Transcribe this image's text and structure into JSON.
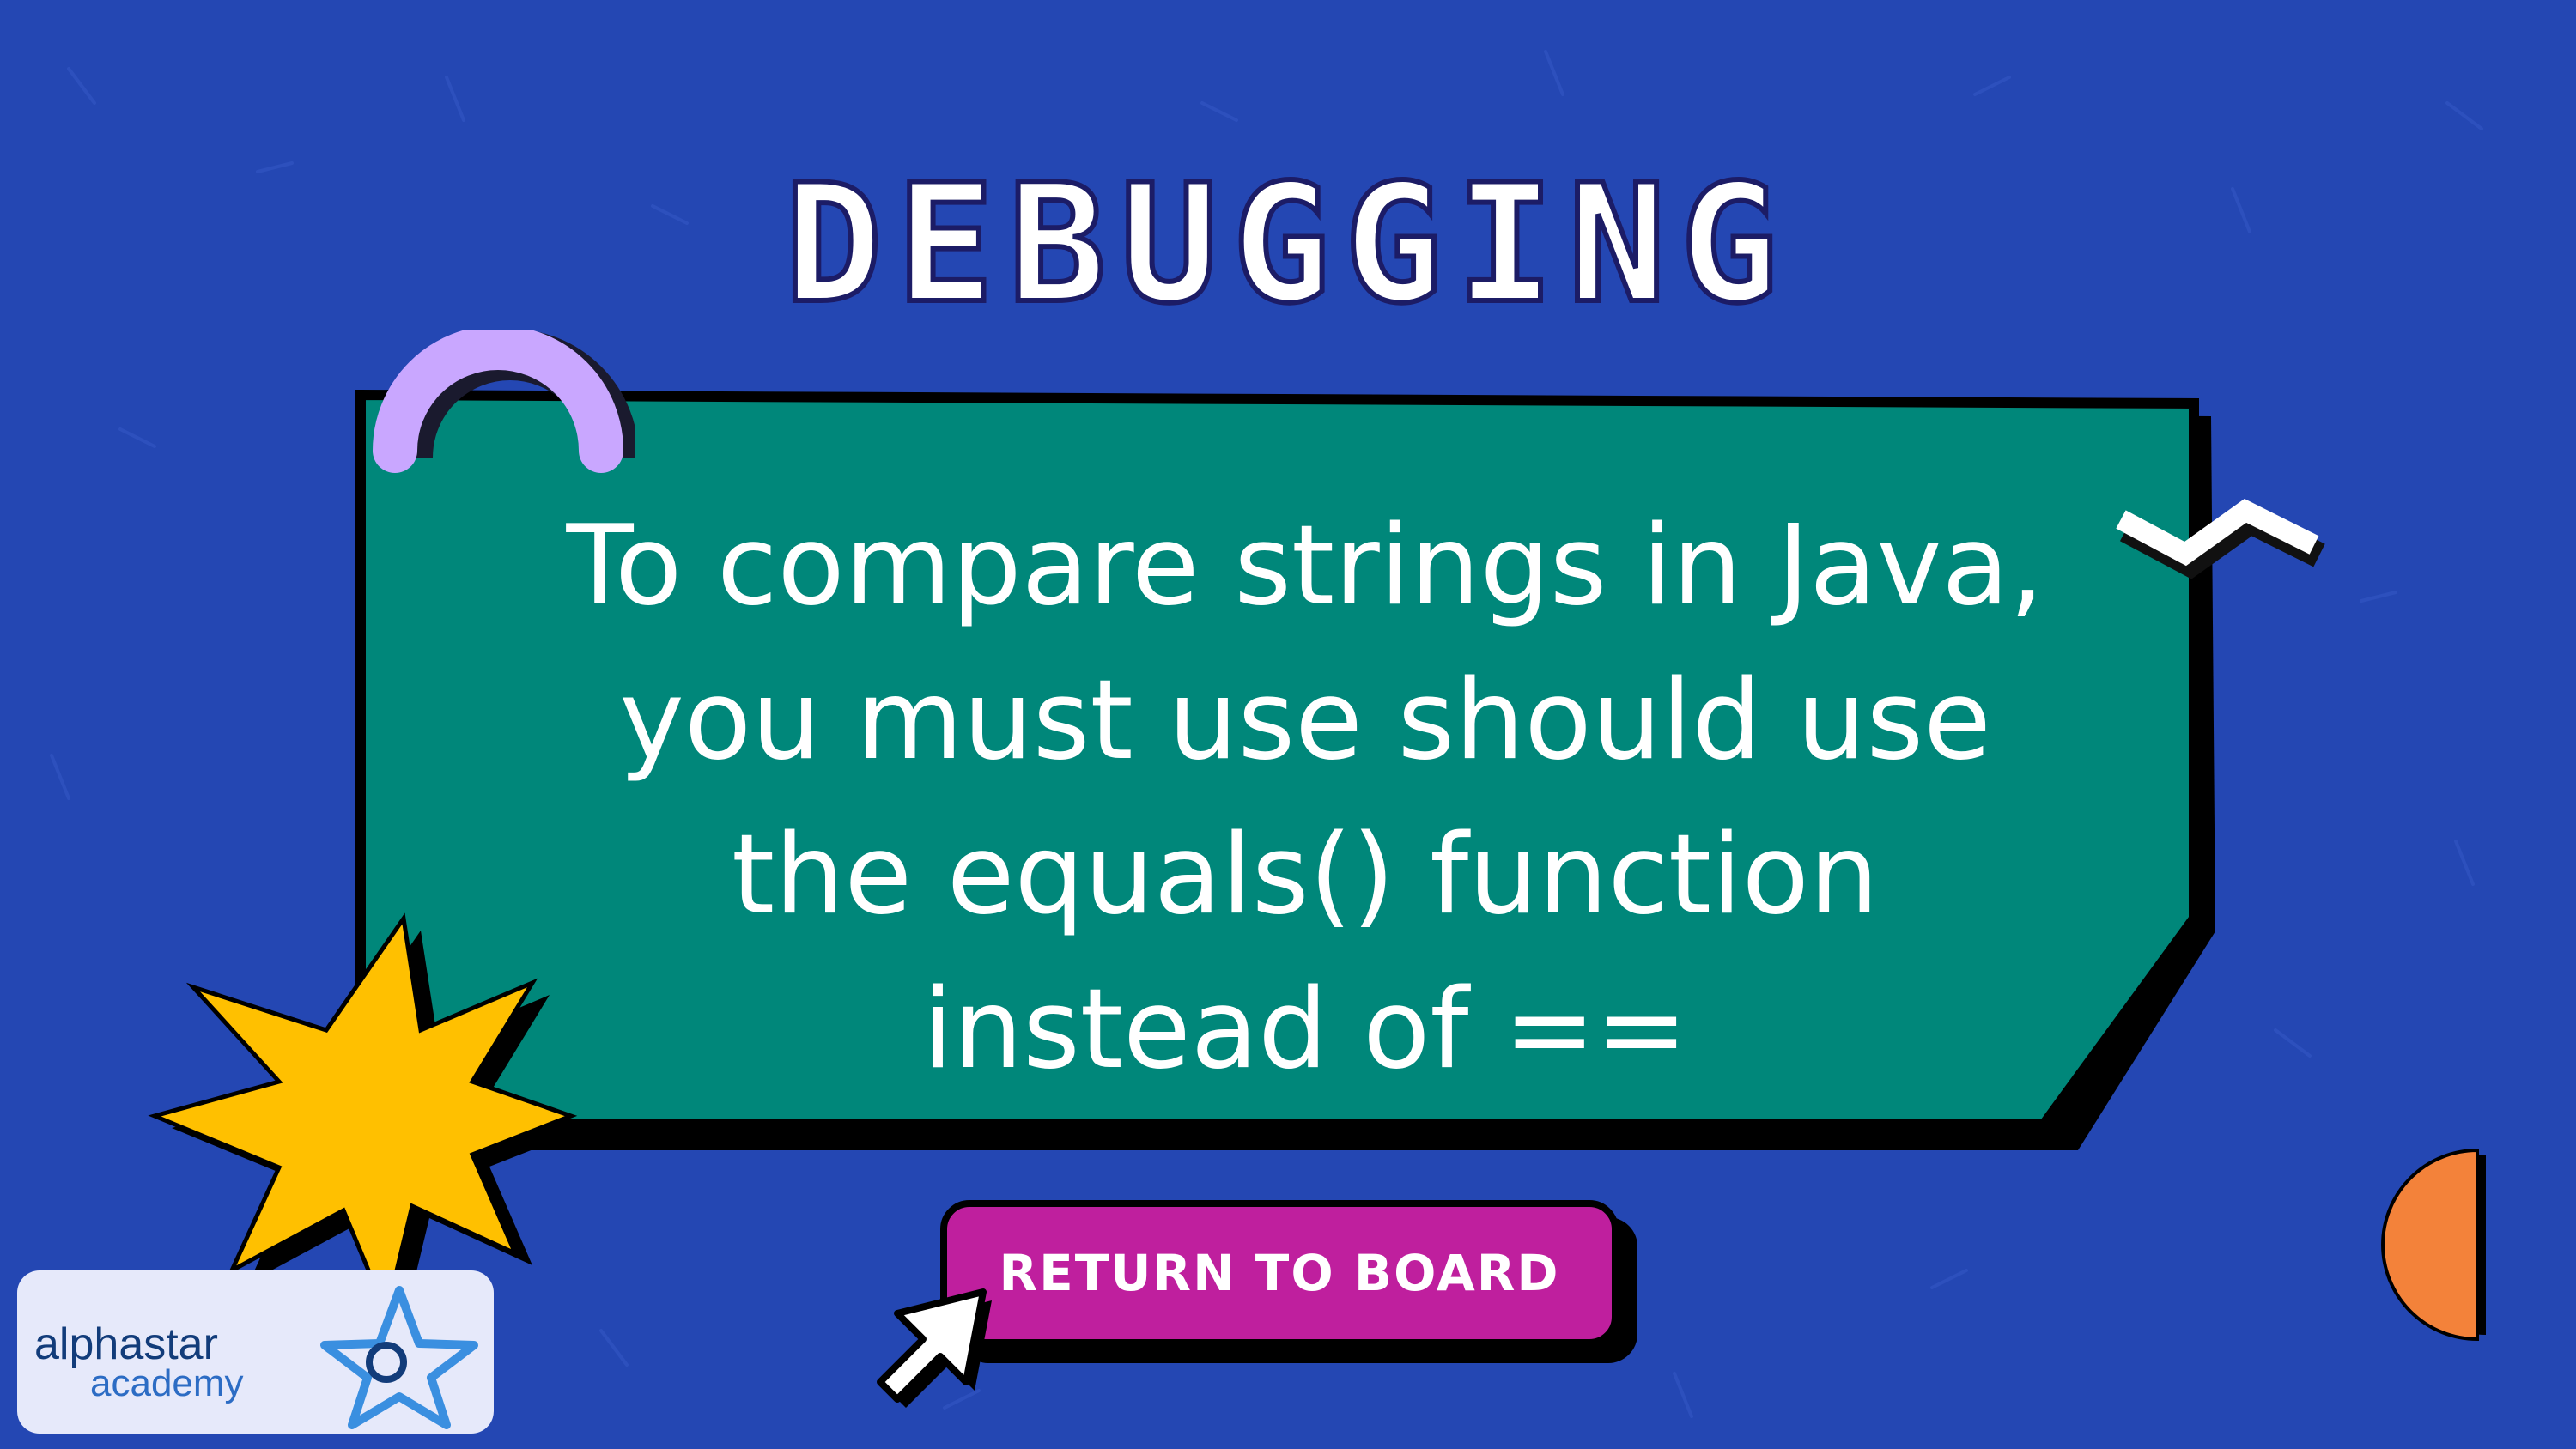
{
  "title": "DEBUGGING",
  "card": {
    "lines": [
      "To compare strings in Java,",
      "you must use should use",
      "the equals() function",
      "instead of =="
    ]
  },
  "button": {
    "label": "RETURN TO BOARD"
  },
  "logo": {
    "name": "alphastar",
    "sub": "academy"
  },
  "icons": [
    "arch-decoration",
    "zigzag-decoration",
    "starburst-decoration",
    "half-circle-decoration",
    "cursor-arrow-icon",
    "logo-star-icon"
  ],
  "colors": {
    "background": "#2447b3",
    "card": "#00877a",
    "button": "#bf1f9e",
    "starburst": "#ffc000",
    "arch": "#c9a7ff",
    "half_circle": "#f3823a"
  }
}
